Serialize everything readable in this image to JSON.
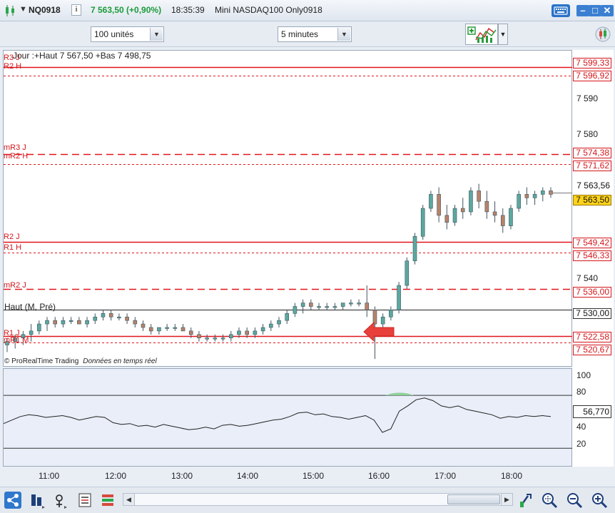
{
  "title_bar": {
    "symbol": "NQ0918",
    "info_label": "i",
    "price_change": "7 563,50 (+0,90%)",
    "time": "18:35:39",
    "description": "Mini NASDAQ100 Only0918",
    "minimize_label": "–",
    "maximize_label": "□",
    "close_label": "✕"
  },
  "toolbar": {
    "units_value": "100 unités",
    "timeframe_value": "5 minutes"
  },
  "chart": {
    "day_legend": "Jour :+Haut 7 567,50 +Bas 7 498,75",
    "haut_legend": "Haut (M, Pré)",
    "copyright": "© ProRealTime Trading",
    "realtime_note": "Données en temps réel",
    "levels": [
      {
        "label": "R3 J",
        "price": "7 599,33",
        "style": "solid"
      },
      {
        "label": "R2 H",
        "price": "7 596,92",
        "style": "dotted"
      },
      {
        "label": "mR3 J",
        "price": "7 574,38",
        "style": "dashed"
      },
      {
        "label": "mR2 H",
        "price": "7 571,62",
        "style": "dotted"
      },
      {
        "label": "R2 J",
        "price": "7 549,42",
        "style": "solid"
      },
      {
        "label": "R1 H",
        "price": "7 546,33",
        "style": "dotted"
      },
      {
        "label": "mR2 J",
        "price": "7 536,00",
        "style": "dashed"
      },
      {
        "label": "R1 J",
        "price": "7 522,58",
        "style": "solid"
      },
      {
        "label": "mR1 M",
        "price": "7 520,67",
        "style": "dotted"
      }
    ],
    "haut_price": "7 530,00",
    "current_price": "7 563,56",
    "last_price": "7 563,50",
    "y_ticks": [
      "7 590",
      "7 580",
      "7 540"
    ],
    "indicator_ticks": [
      "100",
      "80",
      "40",
      "20"
    ],
    "indicator_value": "56,770",
    "time_ticks": [
      "11:00",
      "12:00",
      "13:00",
      "14:00",
      "15:00",
      "16:00",
      "17:00",
      "18:00"
    ]
  },
  "chart_data": {
    "type": "candlestick",
    "y_unit": "price",
    "ylim": [
      7514,
      7604
    ],
    "candles": [
      [
        7520,
        7522,
        7518,
        7521
      ],
      [
        7521,
        7523,
        7519,
        7522
      ],
      [
        7522,
        7524,
        7520,
        7523
      ],
      [
        7523,
        7526,
        7521,
        7524
      ],
      [
        7524,
        7527,
        7523,
        7526
      ],
      [
        7526,
        7528,
        7524,
        7527
      ],
      [
        7527,
        7528,
        7525,
        7526
      ],
      [
        7526,
        7528,
        7525,
        7527
      ],
      [
        7527,
        7528,
        7526,
        7527
      ],
      [
        7527,
        7528,
        7526,
        7526
      ],
      [
        7526,
        7528,
        7525,
        7527
      ],
      [
        7527,
        7529,
        7526,
        7528
      ],
      [
        7528,
        7530,
        7527,
        7529
      ],
      [
        7529,
        7530,
        7527,
        7528
      ],
      [
        7528,
        7529,
        7527,
        7528
      ],
      [
        7528,
        7529,
        7526,
        7527
      ],
      [
        7527,
        7528,
        7525,
        7526
      ],
      [
        7526,
        7527,
        7524,
        7525
      ],
      [
        7525,
        7526,
        7523,
        7524
      ],
      [
        7524,
        7525,
        7523,
        7525
      ],
      [
        7525,
        7526,
        7524,
        7525
      ],
      [
        7525,
        7526,
        7524,
        7525
      ],
      [
        7525,
        7526,
        7524,
        7524
      ],
      [
        7524,
        7525,
        7522,
        7523
      ],
      [
        7523,
        7524,
        7521,
        7522
      ],
      [
        7522,
        7523,
        7521,
        7522
      ],
      [
        7522,
        7523,
        7521,
        7522
      ],
      [
        7522,
        7523,
        7521,
        7522
      ],
      [
        7522,
        7524,
        7521,
        7523
      ],
      [
        7523,
        7525,
        7522,
        7524
      ],
      [
        7524,
        7525,
        7522,
        7523
      ],
      [
        7523,
        7525,
        7522,
        7524
      ],
      [
        7524,
        7526,
        7523,
        7525
      ],
      [
        7525,
        7527,
        7524,
        7526
      ],
      [
        7526,
        7528,
        7525,
        7527
      ],
      [
        7527,
        7530,
        7526,
        7529
      ],
      [
        7529,
        7532,
        7528,
        7531
      ],
      [
        7531,
        7533,
        7529,
        7532
      ],
      [
        7532,
        7533,
        7530,
        7531
      ],
      [
        7531,
        7532,
        7530,
        7531
      ],
      [
        7531,
        7532,
        7530,
        7531
      ],
      [
        7531,
        7532,
        7530,
        7531
      ],
      [
        7531,
        7532,
        7530,
        7532
      ],
      [
        7532,
        7533,
        7531,
        7532
      ],
      [
        7532,
        7533,
        7531,
        7532
      ],
      [
        7532,
        7537,
        7528,
        7530
      ],
      [
        7530,
        7531,
        7516,
        7526
      ],
      [
        7526,
        7529,
        7525,
        7528
      ],
      [
        7528,
        7531,
        7527,
        7530
      ],
      [
        7530,
        7538,
        7529,
        7537
      ],
      [
        7537,
        7545,
        7536,
        7544
      ],
      [
        7544,
        7552,
        7543,
        7551
      ],
      [
        7551,
        7560,
        7550,
        7559
      ],
      [
        7559,
        7564,
        7558,
        7563
      ],
      [
        7563,
        7565,
        7555,
        7557
      ],
      [
        7557,
        7560,
        7553,
        7555
      ],
      [
        7555,
        7560,
        7554,
        7559
      ],
      [
        7559,
        7562,
        7556,
        7558
      ],
      [
        7558,
        7565,
        7557,
        7564
      ],
      [
        7564,
        7566,
        7559,
        7561
      ],
      [
        7561,
        7564,
        7556,
        7558
      ],
      [
        7558,
        7561,
        7555,
        7557
      ],
      [
        7557,
        7559,
        7552,
        7554
      ],
      [
        7554,
        7560,
        7553,
        7559
      ],
      [
        7559,
        7564,
        7558,
        7563
      ],
      [
        7563,
        7565,
        7560,
        7562
      ],
      [
        7562,
        7564,
        7560,
        7563
      ],
      [
        7563,
        7565,
        7561,
        7564
      ],
      [
        7564,
        7565,
        7562,
        7563
      ]
    ],
    "indicator_series": [
      48,
      52,
      56,
      58,
      57,
      55,
      56,
      57,
      55,
      52,
      54,
      56,
      55,
      49,
      47,
      48,
      45,
      46,
      44,
      47,
      45,
      43,
      41,
      42,
      44,
      42,
      46,
      47,
      45,
      46,
      48,
      50,
      52,
      53,
      56,
      60,
      61,
      58,
      59,
      56,
      55,
      53,
      55,
      57,
      52,
      38,
      42,
      62,
      68,
      75,
      77,
      74,
      68,
      66,
      68,
      64,
      62,
      60,
      58,
      54,
      56,
      55,
      57,
      56,
      57,
      56
    ]
  }
}
